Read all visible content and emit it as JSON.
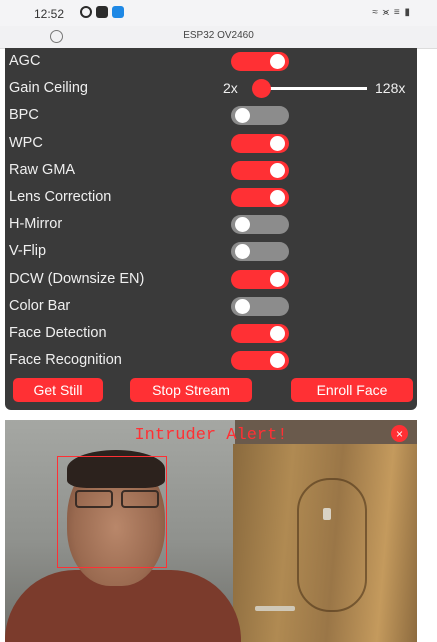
{
  "status_bar": {
    "time": "12:52",
    "right_indicators": "≈ ⪤ ≡ ▮"
  },
  "browser": {
    "page_title": "ESP32 OV2460"
  },
  "controls": [
    {
      "label": "AGC",
      "on": true
    },
    {
      "label": "Gain Ceiling",
      "type": "range",
      "min_label": "2x",
      "max_label": "128x",
      "value_fraction": 0.0
    },
    {
      "label": "BPC",
      "on": false
    },
    {
      "label": "WPC",
      "on": true
    },
    {
      "label": "Raw GMA",
      "on": true
    },
    {
      "label": "Lens Correction",
      "on": true
    },
    {
      "label": "H-Mirror",
      "on": false
    },
    {
      "label": "V-Flip",
      "on": false
    },
    {
      "label": "DCW (Downsize EN)",
      "on": true
    },
    {
      "label": "Color Bar",
      "on": false
    },
    {
      "label": "Face Detection",
      "on": true
    },
    {
      "label": "Face Recognition",
      "on": true
    }
  ],
  "buttons": {
    "get_still": "Get Still",
    "stop_stream": "Stop Stream",
    "enroll_face": "Enroll Face"
  },
  "stream": {
    "alert": "Intruder Alert!",
    "close": "×"
  },
  "colors": {
    "accent": "#ff3034",
    "panel": "#3a3a3a",
    "toggle_off": "#8c8c8c"
  }
}
